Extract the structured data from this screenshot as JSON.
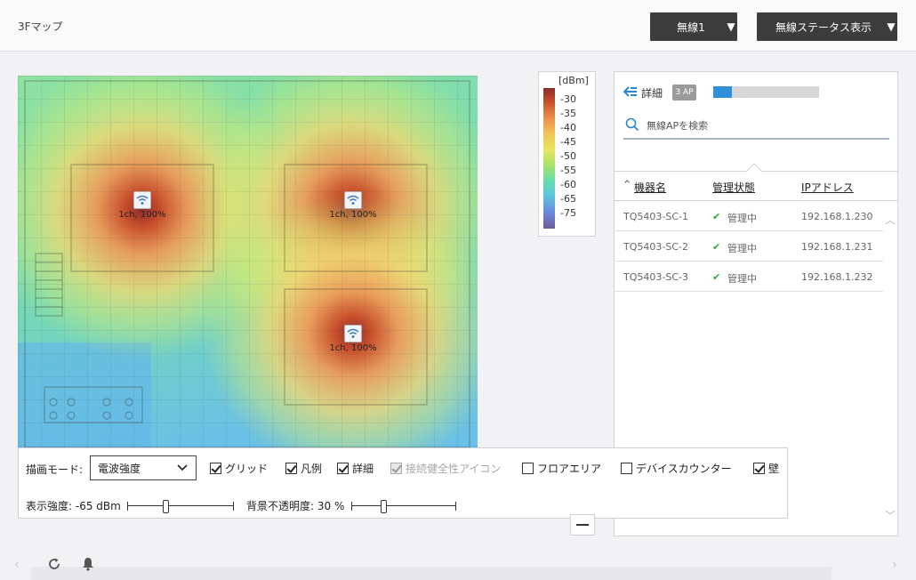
{
  "header": {
    "map_title": "3Fマップ",
    "wireless_select": "無線1",
    "status_select": "無線ステータス表示"
  },
  "map": {
    "access_points": [
      {
        "label": "1ch, 100%"
      },
      {
        "label": "1ch, 100%"
      },
      {
        "label": "1ch, 100%"
      }
    ]
  },
  "legend": {
    "unit": "[dBm]",
    "ticks": [
      "-30",
      "-35",
      "-40",
      "-45",
      "-50",
      "-55",
      "-60",
      "-65",
      "-75"
    ]
  },
  "panel": {
    "title": "詳細",
    "ap_count_badge": "3 AP",
    "progress_fraction": 0.18,
    "search_placeholder": "無線APを検索",
    "columns": {
      "name": "機器名",
      "status": "管理状態",
      "ip": "IPアドレス"
    },
    "rows": [
      {
        "name": "TQ5403-SC-1",
        "status": "管理中",
        "ip": "192.168.1.230"
      },
      {
        "name": "TQ5403-SC-2",
        "status": "管理中",
        "ip": "192.168.1.231"
      },
      {
        "name": "TQ5403-SC-3",
        "status": "管理中",
        "ip": "192.168.1.232"
      }
    ]
  },
  "controls": {
    "draw_mode_label": "描画モード:",
    "draw_mode_value": "電波強度",
    "grid": {
      "label": "グリッド",
      "checked": true
    },
    "legend": {
      "label": "凡例",
      "checked": true
    },
    "detail": {
      "label": "詳細",
      "checked": true
    },
    "health_icon": {
      "label": "接続健全性アイコン",
      "checked": true,
      "disabled": true
    },
    "floor_area": {
      "label": "フロアエリア",
      "checked": false
    },
    "device_counter": {
      "label": "デバイスカウンター",
      "checked": false
    },
    "wall": {
      "label": "壁",
      "checked": true
    },
    "display_strength_label": "表示強度: -65 dBm",
    "display_strength_fraction": 0.35,
    "bg_opacity_label": "背景不透明度: 30 %",
    "bg_opacity_fraction": 0.3
  },
  "colors": {
    "accent": "#2f8fd8",
    "dark_button": "#3c3c3c",
    "ok_green": "#3aa446"
  }
}
